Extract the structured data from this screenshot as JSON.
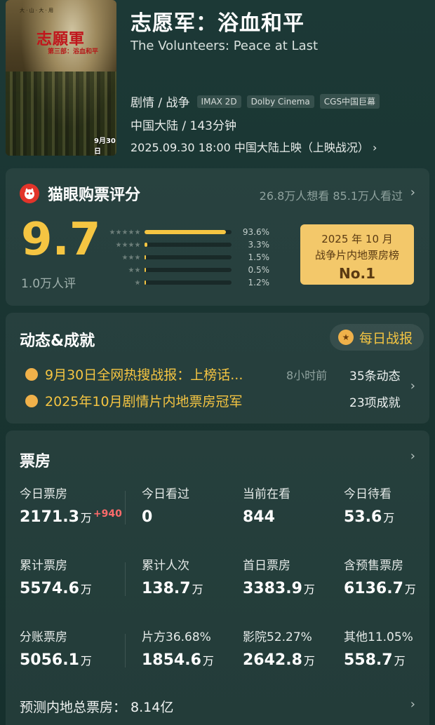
{
  "movie": {
    "title_cn": "志愿军：浴血和平",
    "title_en": "The Volunteers: Peace at Last",
    "genre": "剧情 / 战争",
    "formats": [
      "IMAX 2D",
      "Dolby Cinema",
      "CGS中国巨幕"
    ],
    "region_duration": "中国大陆 / 143分钟",
    "release": "2025.09.30 18:00 中国大陆上映（上映战况）",
    "poster": {
      "top_text": "大 · 山 · 大 · 用",
      "title": "志願軍",
      "subtitle": "第三部：浴血和平",
      "date": "9月30日"
    }
  },
  "rating": {
    "title": "猫眼购票评分",
    "stats": "26.8万人想看 85.1万人看过",
    "score": "9.7",
    "count": "1.0万人评",
    "distribution": [
      {
        "stars": 5,
        "pct": 93.6,
        "label": "93.6%"
      },
      {
        "stars": 4,
        "pct": 3.3,
        "label": "3.3%"
      },
      {
        "stars": 3,
        "pct": 1.5,
        "label": "1.5%"
      },
      {
        "stars": 2,
        "pct": 0.5,
        "label": "0.5%"
      },
      {
        "stars": 1,
        "pct": 1.2,
        "label": "1.2%"
      }
    ],
    "rank_line1": "2025 年 10 月",
    "rank_line2": "战争片内地票房榜",
    "rank_line3": "No.1"
  },
  "news": {
    "title": "动态&成就",
    "daily_button": "每日战报",
    "item1": "9月30日全网热搜战报：上榜话...",
    "item1_time": "8小时前",
    "item2": "2025年10月剧情片内地票房冠军",
    "count1": "35条动态",
    "count2": "23项成就"
  },
  "boxoffice": {
    "title": "票房",
    "today_label": "今日票房",
    "today_value": "2171.3",
    "today_unit": "万",
    "today_delta": "+940",
    "watched_label": "今日看过",
    "watched_value": "0",
    "watching_label": "当前在看",
    "watching_value": "844",
    "pending_label": "今日待看",
    "pending_value": "53.6",
    "pending_unit": "万",
    "total_label": "累计票房",
    "total_value": "5574.6",
    "total_unit": "万",
    "people_label": "累计人次",
    "people_value": "138.7",
    "people_unit": "万",
    "firstday_label": "首日票房",
    "firstday_value": "3383.9",
    "firstday_unit": "万",
    "presale_label": "含预售票房",
    "presale_value": "6136.7",
    "presale_unit": "万",
    "split_label": "分账票房",
    "split_value": "5056.1",
    "split_unit": "万",
    "producer_label": "片方36.68%",
    "producer_value": "1854.6",
    "producer_unit": "万",
    "cinema_label": "影院52.27%",
    "cinema_value": "2642.8",
    "cinema_unit": "万",
    "other_label": "其他11.05%",
    "other_value": "558.7",
    "other_unit": "万",
    "forecast": "预测内地总票房：  8.14亿"
  }
}
